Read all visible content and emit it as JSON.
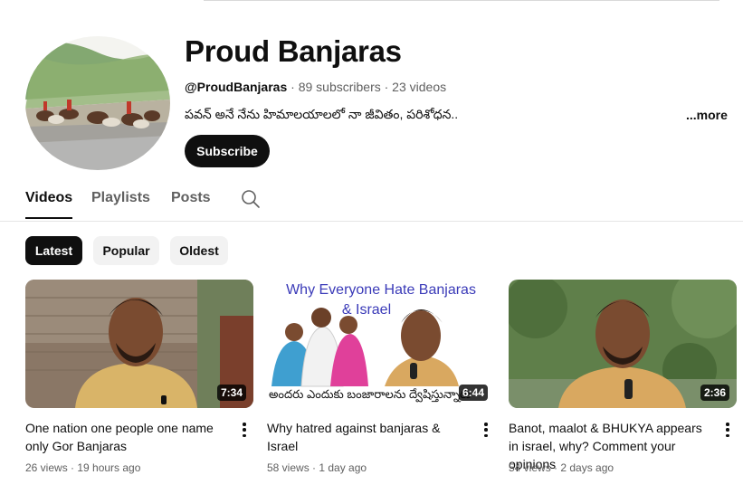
{
  "channel": {
    "name": "Proud Banjaras",
    "handle": "@ProudBanjaras",
    "stats": " · 89 subscribers · 23 videos",
    "description": "పవన్ అనే నేను హిమాలయాలలో నా జీవితం, పరిశోధన..",
    "more_label": "...more",
    "subscribe_label": "Subscribe"
  },
  "tabs": [
    {
      "label": "Videos",
      "active": true
    },
    {
      "label": "Playlists",
      "active": false
    },
    {
      "label": "Posts",
      "active": false
    }
  ],
  "filters": [
    {
      "label": "Latest",
      "active": true
    },
    {
      "label": "Popular",
      "active": false
    },
    {
      "label": "Oldest",
      "active": false
    }
  ],
  "videos": [
    {
      "title": "One nation one people one name only Gor Banjaras",
      "duration": "7:34",
      "meta": "26 views · 19 hours ago"
    },
    {
      "title": "Why hatred against banjaras & Israel",
      "duration": "6:44",
      "meta": "58 views · 1 day ago",
      "thumb_line1": "Why Everyone Hate Banjaras",
      "thumb_line2": "& Israel",
      "thumb_bottom": "అందరు ఎందుకు బంజారాలను ద్వేషిస్తున్నారు"
    },
    {
      "title": "Banot, maalot & BHUKYA appears in israel, why? Comment your opinions",
      "duration": "2:36",
      "meta": "54 views · 2 days ago"
    }
  ],
  "icons": {
    "search": "search-icon",
    "more_actions": "more-vert-icon"
  }
}
